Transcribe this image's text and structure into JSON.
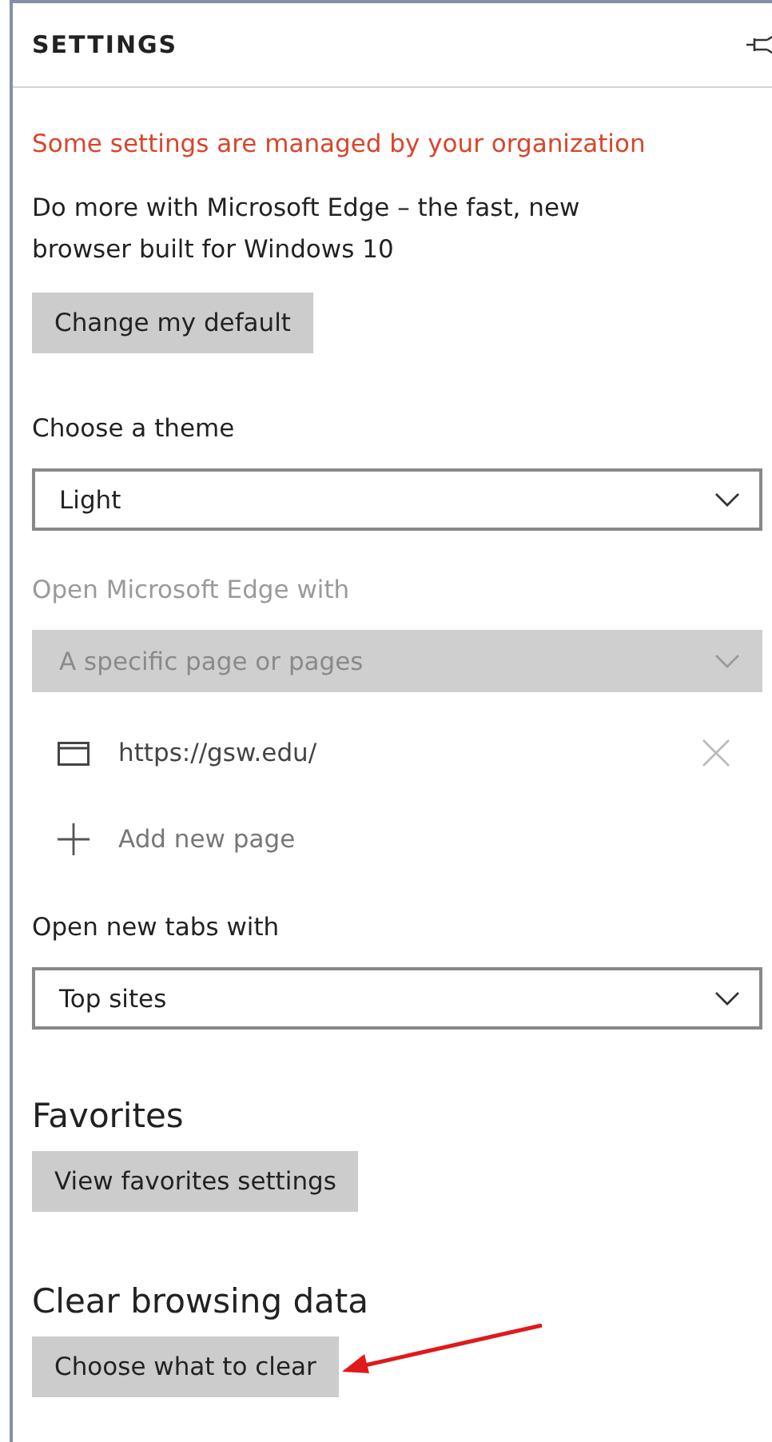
{
  "panel": {
    "title": "SETTINGS"
  },
  "notice": "Some settings are managed by your organization",
  "promo": {
    "text": "Do more with Microsoft Edge – the fast, new browser built for Windows 10",
    "button": "Change my default"
  },
  "dropdowns": [
    {
      "label": "Choose a theme",
      "value": "Light",
      "disabled": false
    },
    {
      "label": "Open Microsoft Edge with",
      "value": "A specific page or pages",
      "disabled": true,
      "pages": [
        {
          "url": "https://gsw.edu/"
        }
      ],
      "add_page": "Add new page"
    },
    {
      "label": "Open new tabs with",
      "value": "Top sites",
      "disabled": false
    }
  ],
  "sections": [
    {
      "heading": "Favorites",
      "button": "View favorites settings",
      "highlighted": false
    },
    {
      "heading": "Clear browsing data",
      "button": "Choose what to clear",
      "highlighted": true
    }
  ]
}
